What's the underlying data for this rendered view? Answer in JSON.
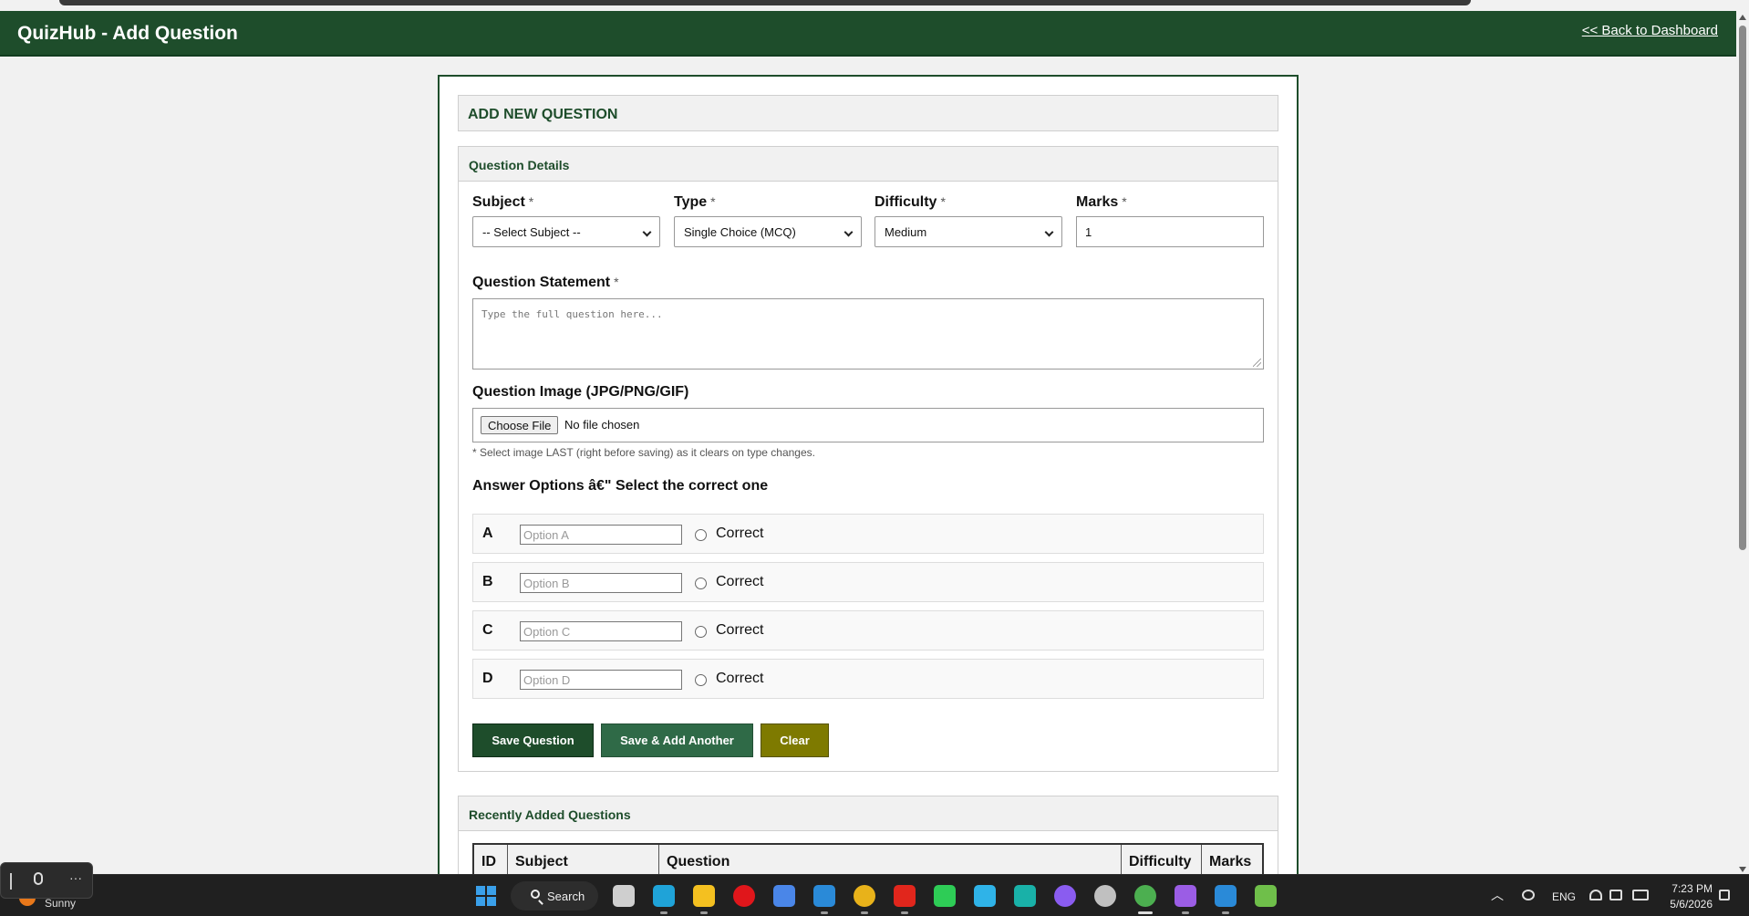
{
  "header": {
    "title": "QuizHub - Add Question",
    "back_link": "<< Back to Dashboard"
  },
  "page": {
    "heading": "ADD NEW QUESTION"
  },
  "question_details": {
    "title": "Question Details",
    "subject": {
      "label": "Subject",
      "required": "*",
      "value": "-- Select Subject --"
    },
    "type": {
      "label": "Type",
      "required": "*",
      "value": "Single Choice (MCQ)"
    },
    "difficulty": {
      "label": "Difficulty",
      "required": "*",
      "value": "Medium"
    },
    "marks": {
      "label": "Marks",
      "required": "*",
      "value": "1"
    },
    "statement": {
      "label": "Question Statement",
      "required": "*",
      "placeholder": "Type the full question here..."
    },
    "image": {
      "label": "Question Image (JPG/PNG/GIF)",
      "button": "Choose File",
      "status": "No file chosen",
      "hint": "* Select image LAST (right before saving) as it clears on type changes."
    },
    "answer_heading": "Answer Options â€\" Select the correct one",
    "options": [
      {
        "letter": "A",
        "placeholder": "Option A",
        "correct_label": "Correct"
      },
      {
        "letter": "B",
        "placeholder": "Option B",
        "correct_label": "Correct"
      },
      {
        "letter": "C",
        "placeholder": "Option C",
        "correct_label": "Correct"
      },
      {
        "letter": "D",
        "placeholder": "Option D",
        "correct_label": "Correct"
      }
    ],
    "buttons": {
      "save": "Save Question",
      "save_add": "Save & Add Another",
      "clear": "Clear"
    }
  },
  "recent": {
    "title": "Recently Added Questions",
    "columns": [
      "ID",
      "Subject",
      "Question",
      "Difficulty",
      "Marks"
    ]
  },
  "taskbar": {
    "weather": "Sunny",
    "search": "Search",
    "language": "ENG",
    "time": "7:23 PM",
    "date": "5/6/2026",
    "mic_dots": "···",
    "icons": [
      "task-view-icon",
      "edge-icon",
      "file-explorer-icon",
      "opera-icon",
      "app-a-icon",
      "vscode-icon",
      "chrome-icon",
      "youtube-icon",
      "whatsapp-icon",
      "play-store-icon",
      "app-c-icon",
      "github-icon",
      "media-player-icon",
      "chrome-active-icon",
      "visual-studio-icon",
      "app-s-icon",
      "notepad-icon"
    ],
    "colors": {
      "task-view-icon": "#cfcfcf",
      "edge-icon": "#1fa3d8",
      "file-explorer-icon": "#f4c020",
      "opera-icon": "#e0161b",
      "app-a-icon": "#4a86e8",
      "vscode-icon": "#2a8ad8",
      "chrome-icon": "#e8b21a",
      "youtube-icon": "#e1261c",
      "whatsapp-icon": "#2ecc56",
      "play-store-icon": "#2fb3e8",
      "app-c-icon": "#19b1a8",
      "github-icon": "#8a5cf0",
      "media-player-icon": "#c0c0c0",
      "chrome-active-icon": "#4caf50",
      "visual-studio-icon": "#9b5de5",
      "app-s-icon": "#2a8ad8",
      "notepad-icon": "#6fbf4a"
    }
  },
  "colors": {
    "brand": "#1e4d2b",
    "save_add": "#2f6a47",
    "clear": "#7e7a00"
  }
}
